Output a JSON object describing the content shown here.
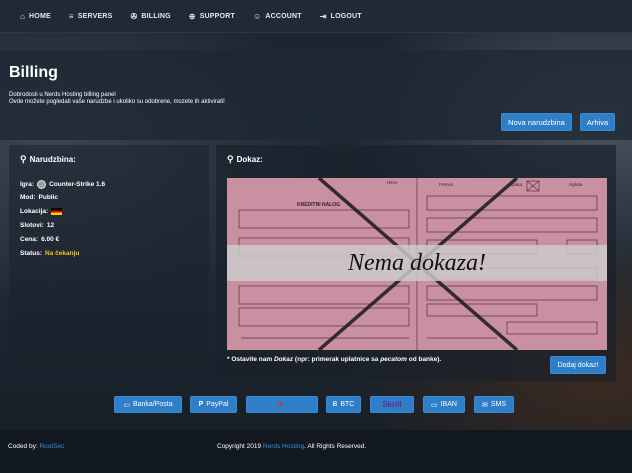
{
  "nav": {
    "items": [
      {
        "label": "HOME",
        "icon": "home-icon",
        "glyph": "⌂"
      },
      {
        "label": "SERVERS",
        "icon": "server-icon",
        "glyph": "≡"
      },
      {
        "label": "BILLING",
        "icon": "cart-icon",
        "glyph": "✇"
      },
      {
        "label": "SUPPORT",
        "icon": "support-icon",
        "glyph": "⊕"
      },
      {
        "label": "ACCOUNT",
        "icon": "user-icon",
        "glyph": "☺"
      },
      {
        "label": "LOGOUT",
        "icon": "logout-icon",
        "glyph": "⇥"
      }
    ]
  },
  "page": {
    "title": "Billing",
    "intro_line1": "Dobrodosli u Nerds Hosting billing panel",
    "intro_line2": "Ovde možete pogledati vaše narudzbe i ukoliko su odobrene, mozete ih aktivirati!",
    "btn_nova": "Nova narudzbina",
    "btn_arhiva": "Arhiva"
  },
  "order": {
    "section_title": "Narudzbina:",
    "igra_label": "Igra:",
    "igra_value": "Counter-Strike 1.6",
    "mod_label": "Mod:",
    "mod_value": "Public",
    "lokacija_label": "Lokacija:",
    "slotovi_label": "Slotovi:",
    "slotovi_value": "12",
    "cena_label": "Cena:",
    "cena_value": "6.00 €",
    "status_label": "Status:",
    "status_value": "Na čekanju"
  },
  "proof": {
    "section_title": "Dokaz:",
    "overlay_text": "Nema dokaza!",
    "note_prefix": "* Ostavite nam ",
    "note_em1": "Dokaz",
    "note_mid": " (npr: primerak uplatnice sa ",
    "note_em2": "pecatom",
    "note_suffix": " od banke).",
    "btn_dodaj": "Dodaj dokaz!",
    "slip_labels": {
      "hitno": "Hitno",
      "prenos": "Prenos",
      "uplata": "Uplata",
      "isplata": "Isplata",
      "kreditni": "KREDITNI NALOG"
    }
  },
  "payments": [
    {
      "label": "Banka/Posta",
      "icon": "bank-icon",
      "glyph": "▭"
    },
    {
      "label": "PayPal",
      "icon": "paypal-icon",
      "glyph": "P"
    },
    {
      "label": "",
      "icon": "card-icon",
      "glyph": "■"
    },
    {
      "label": "BTC",
      "icon": "bitcoin-icon",
      "glyph": "Ƀ"
    },
    {
      "label": "Skrill",
      "icon": "skrill-icon",
      "glyph": ""
    },
    {
      "label": "IBAN",
      "icon": "iban-icon",
      "glyph": "▭"
    },
    {
      "label": "SMS",
      "icon": "sms-icon",
      "glyph": "✉"
    }
  ],
  "footer": {
    "coded_by": "Coded by: ",
    "coder": "RootSec",
    "copyright_prefix": "Copyright 2019 ",
    "brand": "Nerds Hosting",
    "copyright_suffix": ". All Rights Reserved."
  },
  "colors": {
    "accent": "#2f7fc8",
    "status": "#f0c419",
    "link": "#3a8fd8",
    "slip": "#c890a0"
  }
}
